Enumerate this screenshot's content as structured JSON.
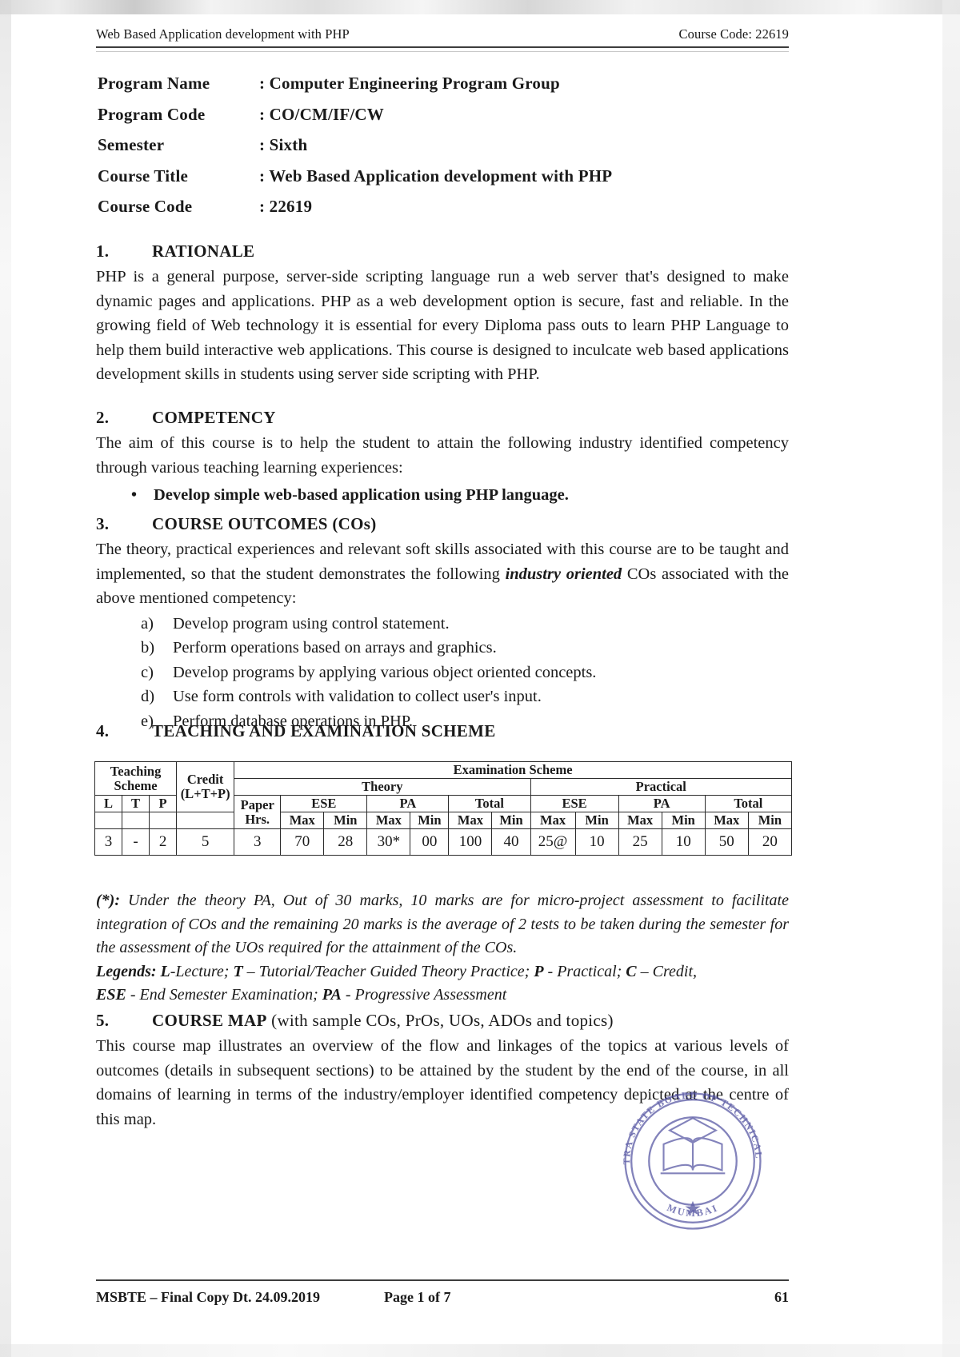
{
  "header": {
    "left": "Web Based Application development with PHP",
    "right": "Course Code: 22619"
  },
  "meta": [
    {
      "label": "Program Name",
      "value": ": Computer Engineering Program Group"
    },
    {
      "label": "Program Code",
      "value": ": CO/CM/IF/CW"
    },
    {
      "label": "Semester",
      "value": ": Sixth"
    },
    {
      "label": "Course Title",
      "value": ": Web Based Application development with PHP"
    },
    {
      "label": "Course Code",
      "value": ": 22619"
    }
  ],
  "sections": {
    "rationale": {
      "num": "1.",
      "title": "RATIONALE",
      "body": "PHP is a general purpose, server-side scripting language run a web server that's designed to make dynamic pages and applications. PHP as a web development option is secure, fast and reliable. In the growing field of Web technology it is essential for every Diploma pass outs to learn PHP Language to help them build interactive web applications. This course is designed to inculcate web based applications development skills in students using server side scripting with PHP."
    },
    "competency": {
      "num": "2.",
      "title": "COMPETENCY",
      "body": "The aim of this course is to help the student to attain the following industry identified competency through various teaching learning experiences:",
      "bullets": [
        "Develop simple web-based application using PHP language."
      ]
    },
    "course_outcomes": {
      "num": "3.",
      "title": "COURSE OUTCOMES (COs)",
      "body_part1": "The theory, practical experiences and relevant soft skills associated with this course are to be taught and implemented, so that the student demonstrates the following ",
      "body_emphasis": "industry oriented",
      "body_part2": " COs associated with the above mentioned competency:",
      "items": [
        {
          "mark": "a)",
          "text": "Develop program using control statement."
        },
        {
          "mark": "b)",
          "text": "Perform operations based on arrays and graphics."
        },
        {
          "mark": "c)",
          "text": "Develop programs by applying various object oriented concepts."
        },
        {
          "mark": "d)",
          "text": "Use form controls with validation to collect user's input."
        },
        {
          "mark": "e)",
          "text": "Perform database operations in PHP."
        }
      ]
    },
    "teaching_exam": {
      "num": "4.",
      "title": "TEACHING AND EXAMINATION SCHEME"
    },
    "course_map": {
      "num": "5.",
      "title": "COURSE MAP",
      "title_suffix": "(with sample COs, PrOs, UOs, ADOs and topics)",
      "body": "This course map illustrates an overview of the flow and linkages of the topics at various levels of outcomes (details in subsequent sections) to be attained by the student by the end of the course, in all domains of learning in terms of the industry/employer identified competency depicted at the centre of this map."
    }
  },
  "scheme_table": {
    "group_teaching": "Teaching Scheme",
    "group_teaching_line1": "Teaching",
    "group_teaching_line2": "Scheme",
    "credit_line1": "Credit",
    "credit_line2": "(L+T+P)",
    "group_exam": "Examination Scheme",
    "group_theory": "Theory",
    "group_practical": "Practical",
    "paper_line1": "Paper",
    "paper_line2": "Hrs.",
    "teaching_cols": [
      "L",
      "T",
      "P"
    ],
    "sub_groups": [
      "ESE",
      "PA",
      "Total",
      "ESE",
      "PA",
      "Total"
    ],
    "minmax": [
      "Max",
      "Min",
      "Max",
      "Min",
      "Max",
      "Min",
      "Max",
      "Min",
      "Max",
      "Min",
      "Max",
      "Min"
    ],
    "row": {
      "L": "3",
      "T": "-",
      "P": "2",
      "credit": "5",
      "paper_hrs": "3",
      "th_ese_max": "70",
      "th_ese_min": "28",
      "th_pa_max": "30*",
      "th_pa_min": "00",
      "th_total_max": "100",
      "th_total_min": "40",
      "pr_ese_max": "25@",
      "pr_ese_min": "10",
      "pr_pa_max": "25",
      "pr_pa_min": "10",
      "pr_total_max": "50",
      "pr_total_min": "20"
    }
  },
  "notes": {
    "star_prefix": "(*):",
    "star_text": " Under the theory PA, Out of 30 marks, 10 marks are for micro-project assessment to facilitate integration of COs and the remaining 20 marks is the average of 2 tests to be taken during the semester for the assessment of the UOs required for the attainment of the COs.",
    "legends_label": "Legends:",
    "legends_line1_a": " L",
    "legends_line1_b": "-Lecture; ",
    "legends_line1_c": "T",
    "legends_line1_d": " – Tutorial/Teacher Guided Theory Practice; ",
    "legends_line1_e": "P",
    "legends_line1_f": " - Practical; ",
    "legends_line1_g": "C",
    "legends_line1_h": " – Credit,",
    "legends_line2_a": "ESE",
    "legends_line2_b": " - End Semester Examination; ",
    "legends_line2_c": "PA",
    "legends_line2_d": " - Progressive Assessment"
  },
  "footer": {
    "left": "MSBTE – Final Copy Dt. 24.09.2019",
    "center": "Page 1 of 7",
    "right": "61"
  },
  "stamp": {
    "outer_text_top": "MAHARASHTRA STATE BOARD OF TECHNICAL EDUCATION",
    "inner_text_bottom": "MUMBAI",
    "color": "#4a4a9c"
  }
}
